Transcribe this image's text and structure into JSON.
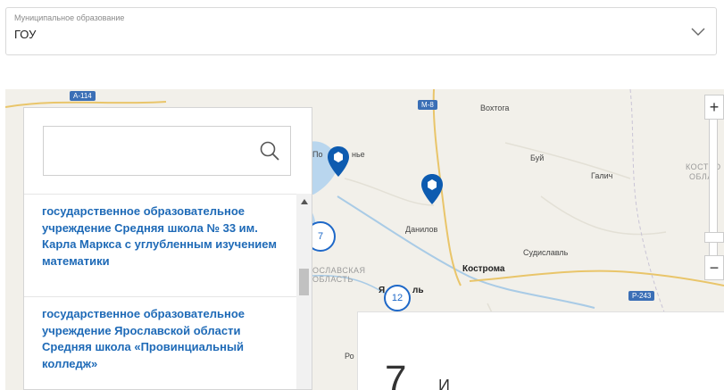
{
  "filter": {
    "label": "Муниципальное образование",
    "value": "ГОУ",
    "icon": "chevron-down-icon"
  },
  "map": {
    "roads": [
      {
        "label": "A-114",
        "color": "#3b6fb6"
      },
      {
        "label": "M-8",
        "color": "#3b6fb6"
      },
      {
        "label": "P-243",
        "color": "#3b6fb6"
      }
    ],
    "places": {
      "vokhtoga": "Вохтога",
      "buy": "Буй",
      "galich": "Галич",
      "danilov": "Данилов",
      "poshekhonye_a": "По",
      "poshekhonye_b": "нье",
      "kostroma": "Кострома",
      "sudislavl": "Судиславль",
      "kostroma_region_1": "КОСТРО",
      "kostroma_region_2": "ОБЛА",
      "yaroslavl_region_1": "ОСЛАВСКАЯ",
      "yaroslavl_region_2": "ОБЛАСТЬ",
      "yaroslavl_part": "ль",
      "ya_part": "Я",
      "ro_part": "Ро"
    },
    "clusters": [
      "7",
      "12"
    ],
    "zoom_in": "+",
    "zoom_out": "−"
  },
  "panel": {
    "search_placeholder": "",
    "items": [
      {
        "title": "государственное образовательное учреждение Средняя школа № 33 им. Карла Маркса с углубленным изучением математики"
      },
      {
        "title": "государственное образовательное учреждение Ярославской области Средняя школа «Провинциальный колледж»"
      }
    ]
  },
  "card": {
    "number": "7",
    "text": "И"
  }
}
